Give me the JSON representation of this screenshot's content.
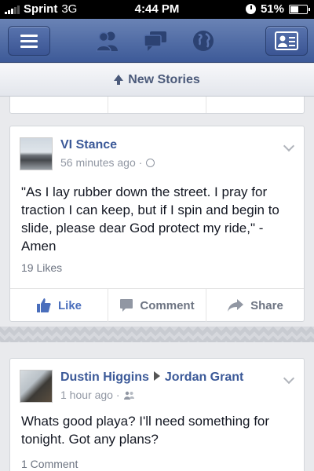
{
  "status_bar": {
    "carrier": "Sprint",
    "network": "3G",
    "time": "4:44 PM",
    "battery": "51%",
    "battery_level": 0.51
  },
  "nav": {
    "icons": [
      "menu-icon",
      "friend-requests-icon",
      "messages-icon",
      "notifications-globe-icon",
      "friends-list-icon"
    ]
  },
  "new_stories": {
    "label": "New Stories"
  },
  "posts": [
    {
      "author": "VI Stance",
      "time": "56 minutes ago ·",
      "text": "\"As I lay rubber down the street. I pray for traction I can keep, but if I spin and begin to slide, please dear God protect my ride,\" - Amen",
      "likes": "19 Likes",
      "actions": {
        "like": "Like",
        "comment": "Comment",
        "share": "Share"
      }
    },
    {
      "author": "Dustin Higgins",
      "recipient": "Jordan Grant",
      "time": "1 hour ago ·",
      "text": "Whats good playa? I'll need something for tonight. Got any plans?",
      "comments": "1 Comment"
    }
  ],
  "colors": {
    "nav_blue": "#3d5a98",
    "link_blue": "#3b5998",
    "like_blue": "#4a6ebc",
    "feed_bg": "#e9eaed"
  }
}
